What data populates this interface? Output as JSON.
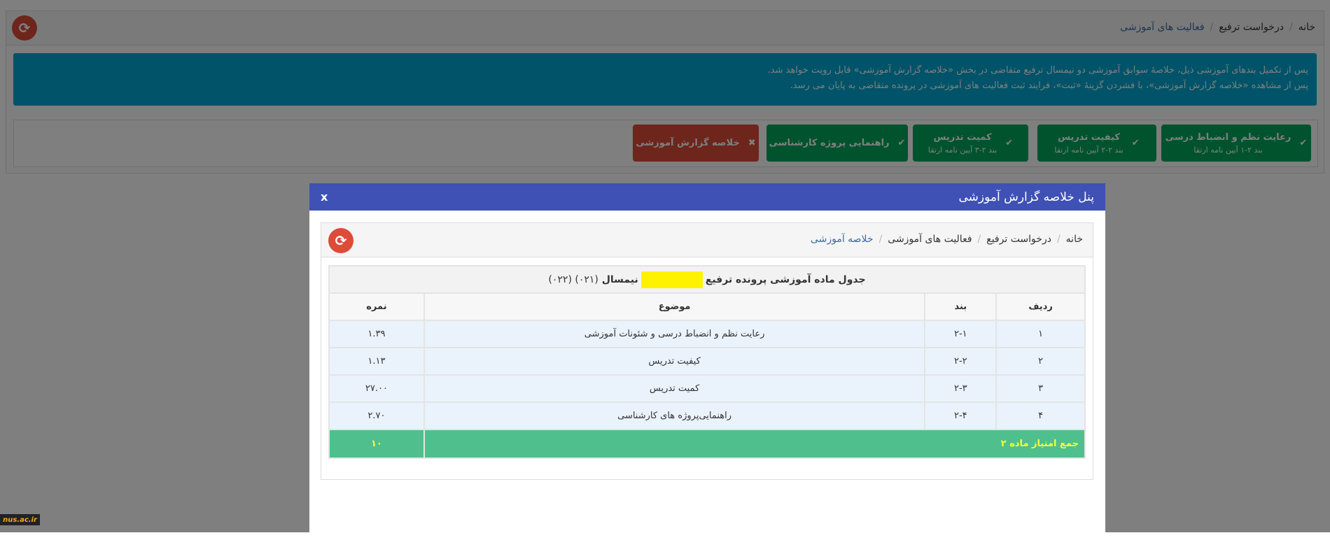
{
  "page": {
    "breadcrumb": [
      "خانه",
      "درخواست ترفیع",
      "فعالیت های آموزشی"
    ],
    "alert_lines": [
      "پس از تکمیل بندهای آموزشی ذیل، خلاصهٔ سوابق آموزشی دو نیمسال ترفیع متقاضی در بخش «خلاصه گزارش آموزشی» قابل رویت خواهد شد.",
      "پس از مشاهده «خلاصه گزارش آموزشی»، با فشردن گزینهٔ «ثبت»، فرایند ثبت فعالیت های آموزشی در پرونده متقاضی به پایان می رسد."
    ],
    "steps": [
      {
        "label": "رعایت نظم و انضباط درسی",
        "sub": "بند ۲-۱ آیین نامه ارتقا",
        "icon": "check"
      },
      {
        "label": "کیفیت تدریس",
        "sub": "بند ۲-۲ آیین نامه ارتقا",
        "icon": "check"
      },
      {
        "label": "کمیت تدریس",
        "sub": "بند ۲-۳ آیین نامه ارتقا",
        "icon": "check"
      },
      {
        "label": "راهنمایی پروژه کارشناسی",
        "icon": "check"
      },
      {
        "label": "خلاصه گزارش آموزشی",
        "icon": "x"
      }
    ]
  },
  "modal": {
    "title": "پنل خلاصه گزارش آموزشی",
    "close": "x",
    "breadcrumb": [
      "خانه",
      "درخواست ترفیع",
      "فعالیت های آموزشی",
      "خلاصه آموزشی"
    ],
    "table": {
      "title": "جدول ماده آموزشی پرونده ترفیع",
      "semester_label": "نیمسال",
      "semesters": "(۰۲۱) (۰۲۲)",
      "headers": [
        "ردیف",
        "بند",
        "موضوع",
        "نمره"
      ],
      "rows": [
        [
          "۱",
          "۲-۱",
          "رعایت نظم و انضباط درسی و شئونات آموزشی",
          "۱.۳۹"
        ],
        [
          "۲",
          "۲-۲",
          "کیفیت تدریس",
          "۱.۱۳"
        ],
        [
          "۳",
          "۲-۳",
          "کمیت تدریس",
          "۲۷.۰۰"
        ],
        [
          "۴",
          "۲-۴",
          "راهنمایی‌پروژه های کارشناسی",
          "۲.۷۰"
        ]
      ],
      "total_label": "جمع امتیاز ماده ۲",
      "total_value": "۱۰"
    }
  },
  "watermark": "nus.ac.ir"
}
